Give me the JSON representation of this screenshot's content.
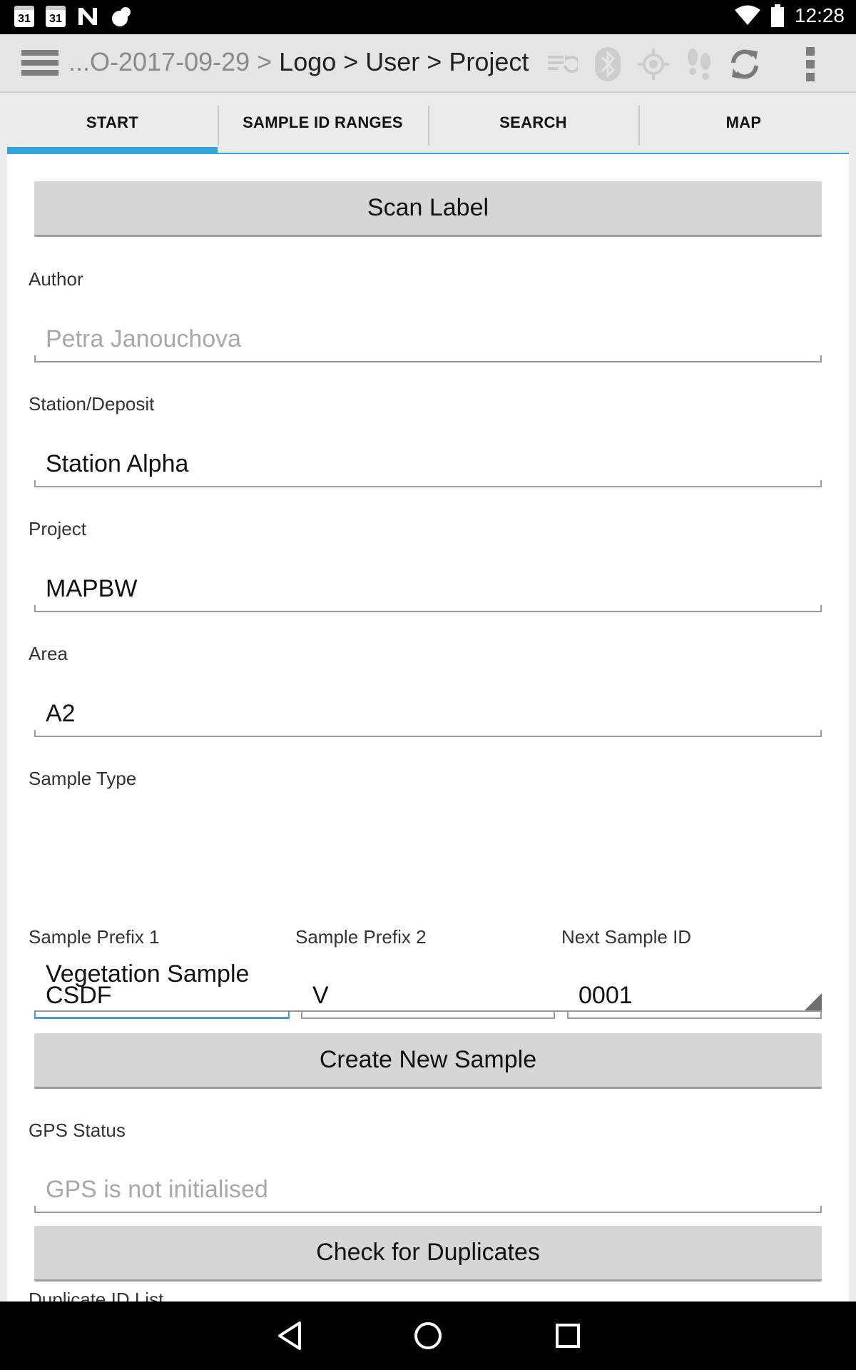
{
  "status_bar": {
    "time": "12:28",
    "calendar_day_1": "31",
    "calendar_day_2": "31",
    "icons": [
      "calendar-icon",
      "calendar-icon",
      "notification-n-icon",
      "cloud-icon",
      "wifi-icon",
      "battery-icon"
    ]
  },
  "action_bar": {
    "breadcrumb_prefix": "...O-2017-09-29 > ",
    "breadcrumb_path": "Logo > User > Project",
    "icons": [
      "sync-list-icon",
      "bluetooth-icon",
      "gps-target-icon",
      "footsteps-icon",
      "refresh-icon",
      "overflow-menu-icon"
    ]
  },
  "tabs": [
    {
      "label": "START",
      "active": true
    },
    {
      "label": "SAMPLE ID RANGES",
      "active": false
    },
    {
      "label": "SEARCH",
      "active": false
    },
    {
      "label": "MAP",
      "active": false
    }
  ],
  "form": {
    "scan_label_button": "Scan Label",
    "author": {
      "label": "Author",
      "placeholder": "Petra Janouchova"
    },
    "station": {
      "label": "Station/Deposit",
      "value": "Station Alpha"
    },
    "project": {
      "label": "Project",
      "value": "MAPBW"
    },
    "area": {
      "label": "Area",
      "value": "A2"
    },
    "sample_type": {
      "label": "Sample Type",
      "value": "Vegetation Sample"
    },
    "prefix1": {
      "label": "Sample Prefix 1",
      "value": "CSDF"
    },
    "prefix2": {
      "label": "Sample Prefix 2",
      "value": "V"
    },
    "next_id": {
      "label": "Next Sample ID",
      "value": "0001"
    },
    "create_button": "Create New Sample",
    "gps": {
      "label": "GPS Status",
      "placeholder": "GPS is not initialised"
    },
    "duplicates_button": "Check for Duplicates",
    "duplicate_list_label": "Duplicate ID List"
  },
  "colors": {
    "accent": "#33a3dc",
    "button_bg": "#d6d6d6",
    "hint_text": "#a8a8a8"
  }
}
